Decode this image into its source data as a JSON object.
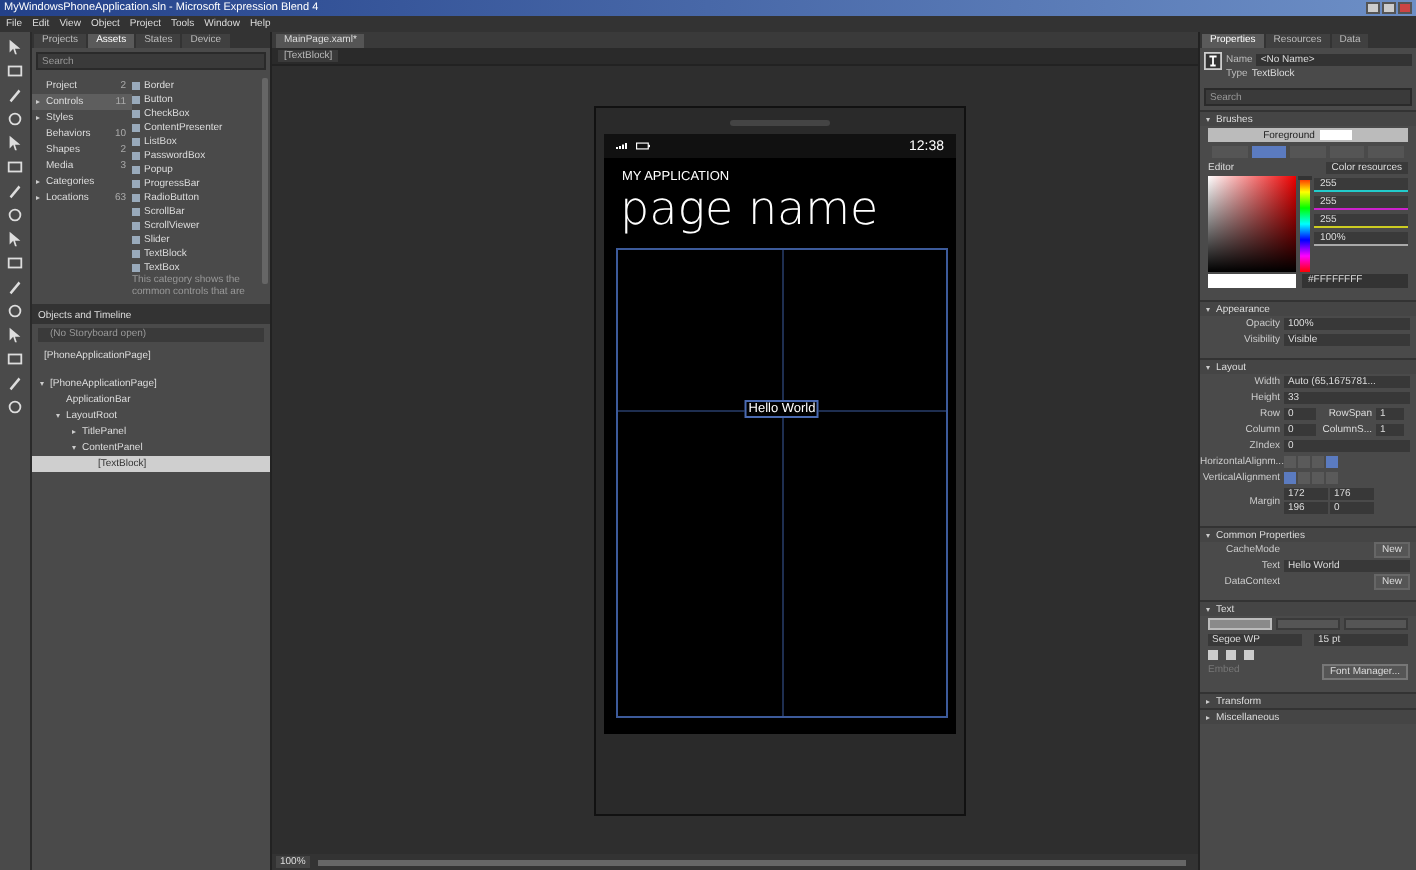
{
  "window": {
    "title": "MyWindowsPhoneApplication.sln - Microsoft Expression Blend 4"
  },
  "menu": [
    "File",
    "Edit",
    "View",
    "Object",
    "Project",
    "Tools",
    "Window",
    "Help"
  ],
  "assets_panel": {
    "tabs": [
      {
        "label": "Projects",
        "selected": false
      },
      {
        "label": "Assets",
        "selected": true
      },
      {
        "label": "States",
        "selected": false
      },
      {
        "label": "Device",
        "selected": false
      }
    ],
    "search": {
      "placeholder": "Search"
    },
    "categories": [
      {
        "label": "Project",
        "count": "2",
        "kind": "leaf",
        "selected": false
      },
      {
        "label": "Controls",
        "count": "11",
        "kind": "group",
        "selected": true
      },
      {
        "label": "Styles",
        "kind": "group",
        "selected": false
      },
      {
        "label": "Behaviors",
        "count": "10",
        "kind": "leaf",
        "selected": false
      },
      {
        "label": "Shapes",
        "count": "2",
        "kind": "leaf",
        "selected": false
      },
      {
        "label": "Media",
        "count": "3",
        "kind": "leaf",
        "selected": false
      },
      {
        "label": "Categories",
        "kind": "group",
        "selected": false
      },
      {
        "label": "Locations",
        "count": "63",
        "kind": "group",
        "selected": false
      }
    ],
    "controls": [
      "Border",
      "Button",
      "CheckBox",
      "ContentPresenter",
      "ListBox",
      "PasswordBox",
      "Popup",
      "ProgressBar",
      "RadioButton",
      "ScrollBar",
      "ScrollViewer",
      "Slider",
      "TextBlock",
      "TextBox"
    ],
    "note": "This category shows the common controls that are"
  },
  "objects_panel": {
    "title": "Objects and Timeline",
    "storyboard": "(No Storyboard open)",
    "scope": "[PhoneApplicationPage]",
    "tree": [
      {
        "label": "[PhoneApplicationPage]",
        "expanded": true,
        "selected": false,
        "children": [
          {
            "label": "ApplicationBar",
            "selected": false
          },
          {
            "label": "LayoutRoot",
            "expanded": true,
            "selected": false,
            "children": [
              {
                "label": "TitlePanel",
                "expanded": false,
                "selected": false
              },
              {
                "label": "ContentPanel",
                "expanded": true,
                "selected": false,
                "children": [
                  {
                    "label": "[TextBlock]",
                    "selected": true
                  }
                ]
              }
            ]
          }
        ]
      }
    ]
  },
  "document": {
    "tab": "MainPage.xaml*",
    "breadcrumb": "[TextBlock]",
    "phone": {
      "time": "12:38",
      "app_title": "MY APPLICATION",
      "page_title": "page name",
      "text": "Hello World"
    },
    "zoom": "100%"
  },
  "properties_panel": {
    "tabs": [
      {
        "label": "Properties",
        "selected": true
      },
      {
        "label": "Resources",
        "selected": false
      },
      {
        "label": "Data",
        "selected": false
      }
    ],
    "name_label": "Name",
    "name": "<No Name>",
    "type_label": "Type",
    "type": "TextBlock",
    "search": {
      "placeholder": "Search"
    },
    "sections": [
      {
        "title": "Brushes",
        "expanded": true,
        "kind": "brushes",
        "property": "Foreground",
        "editor_label": "Editor",
        "resources_label": "Color resources",
        "hue": {
          "level": 0
        },
        "channels": [
          "255",
          "255",
          "255",
          "100%"
        ],
        "hex": "#FFFFFFFF"
      },
      {
        "title": "Appearance",
        "expanded": true,
        "kind": "rows",
        "rows": [
          {
            "kind": "field",
            "label": "Opacity",
            "value": "100%"
          },
          {
            "kind": "select",
            "label": "Visibility",
            "value": "Visible"
          }
        ]
      },
      {
        "title": "Layout",
        "expanded": true,
        "kind": "rows",
        "rows": [
          {
            "kind": "field",
            "label": "Width",
            "value": "Auto (65,1675781..."
          },
          {
            "kind": "field",
            "label": "Height",
            "value": "33"
          },
          {
            "kind": "pair",
            "label": "Row",
            "value": "0",
            "label2": "RowSpan",
            "value2": "1"
          },
          {
            "kind": "pair",
            "label": "Column",
            "value": "0",
            "label2": "ColumnS...",
            "value2": "1"
          },
          {
            "kind": "field",
            "label": "ZIndex",
            "value": "0"
          },
          {
            "kind": "align",
            "label": "HorizontalAlignm...",
            "options": [
              {
                "selected": false
              },
              {
                "selected": false
              },
              {
                "selected": false
              },
              {
                "selected": true
              }
            ]
          },
          {
            "kind": "align",
            "label": "VerticalAlignment",
            "options": [
              {
                "selected": true
              },
              {
                "selected": false
              },
              {
                "selected": false
              },
              {
                "selected": false
              }
            ]
          },
          {
            "kind": "margin",
            "label": "Margin",
            "values": [
              "172",
              "176",
              "196",
              "0"
            ]
          }
        ]
      },
      {
        "title": "Common Properties",
        "expanded": true,
        "kind": "rows",
        "rows": [
          {
            "kind": "button",
            "label": "CacheMode",
            "value": "New"
          },
          {
            "kind": "field",
            "label": "Text",
            "value": "Hello World"
          },
          {
            "kind": "button",
            "label": "DataContext",
            "value": "New"
          }
        ]
      },
      {
        "title": "Text",
        "expanded": true,
        "kind": "text",
        "tabs": [
          {
            "selected": true
          },
          {
            "selected": false
          },
          {
            "selected": false
          }
        ],
        "font": "Segoe WP",
        "size": "15 pt",
        "embed": {
          "label": "Embed",
          "disabled": true
        },
        "manager": "Font Manager..."
      },
      {
        "title": "Transform",
        "expanded": false
      },
      {
        "title": "Miscellaneous",
        "expanded": false
      }
    ]
  }
}
